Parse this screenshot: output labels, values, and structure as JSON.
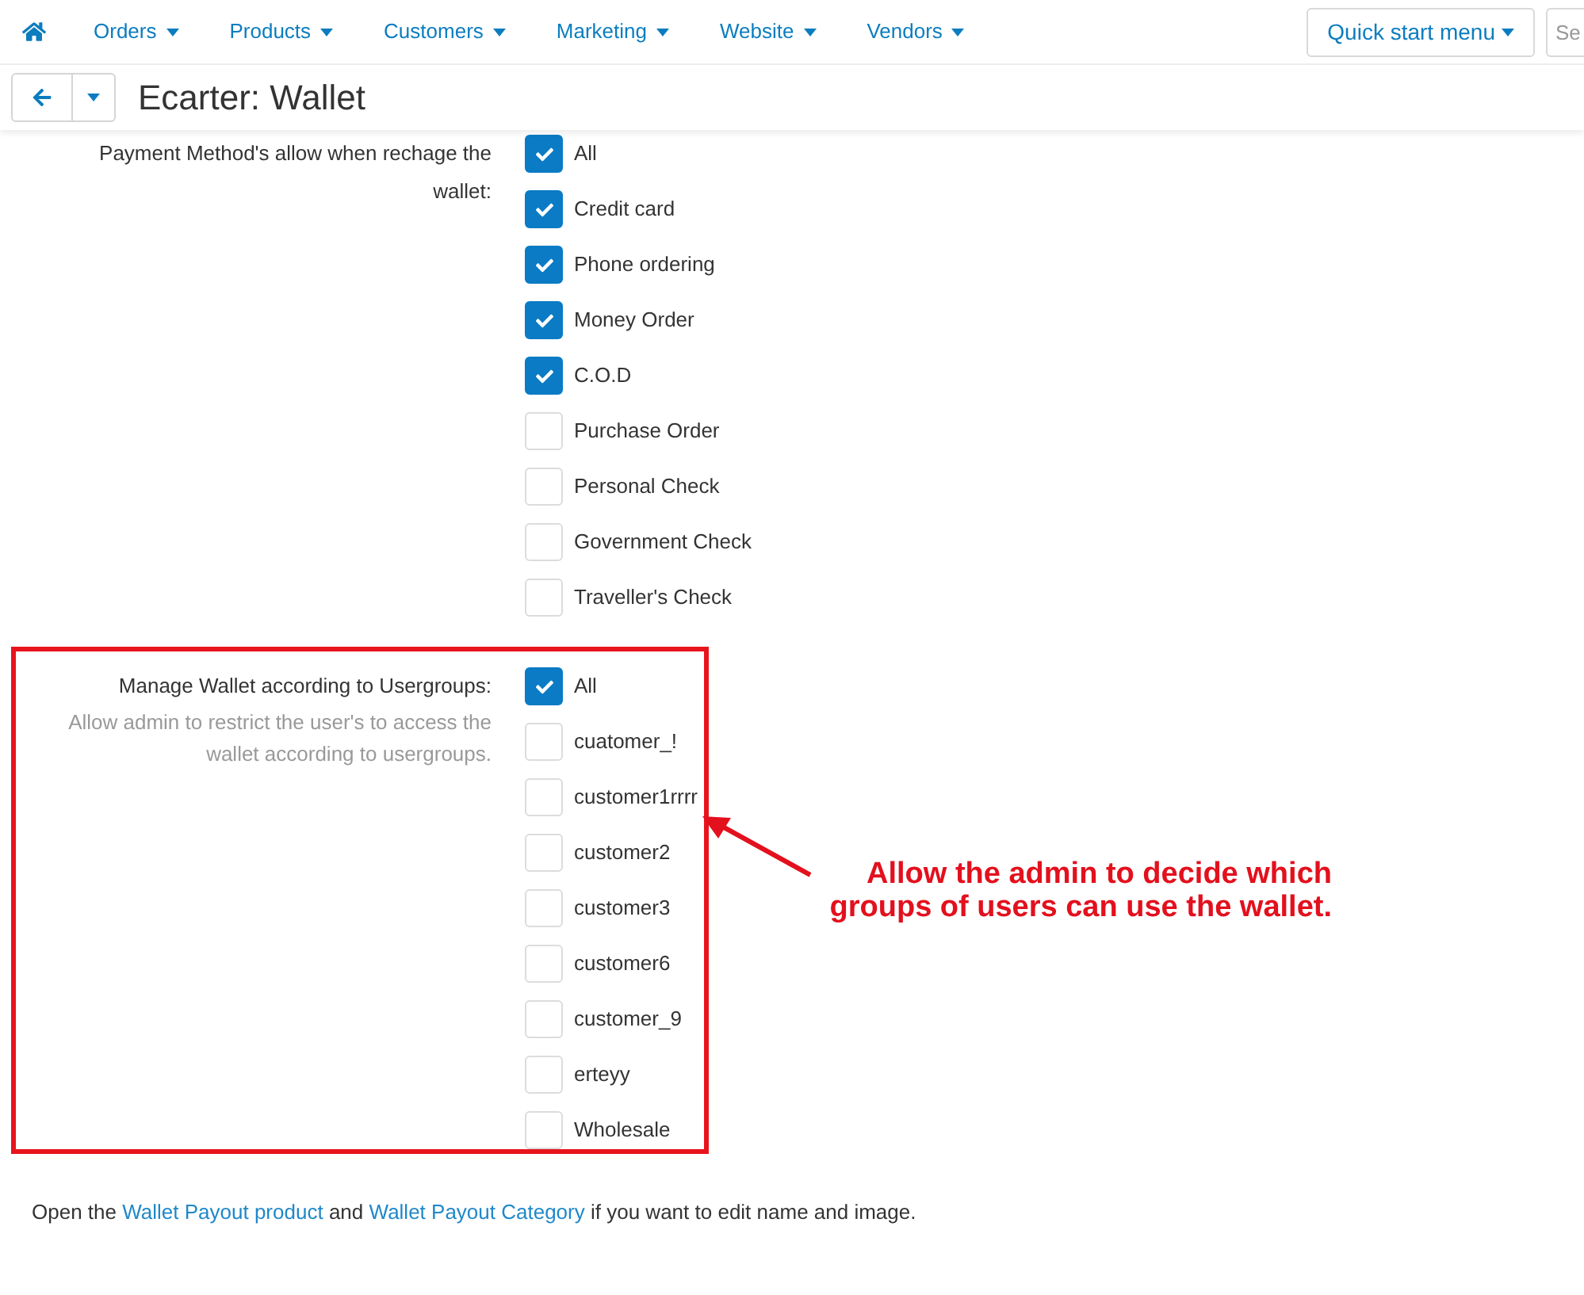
{
  "nav": {
    "items": [
      {
        "label": "Orders"
      },
      {
        "label": "Products"
      },
      {
        "label": "Customers"
      },
      {
        "label": "Marketing"
      },
      {
        "label": "Website"
      },
      {
        "label": "Vendors"
      }
    ],
    "quick_start": "Quick start menu",
    "search": {
      "placeholder": "Se"
    }
  },
  "toolbar": {
    "title": "Ecarter: Wallet"
  },
  "settings": [
    {
      "label": "Payment Method's allow when rechage the wallet:",
      "highlighted": false,
      "options": [
        {
          "label": "All",
          "checked": true
        },
        {
          "label": "Credit card",
          "checked": true
        },
        {
          "label": "Phone ordering",
          "checked": true
        },
        {
          "label": "Money Order",
          "checked": true
        },
        {
          "label": "C.O.D",
          "checked": true
        },
        {
          "label": "Purchase Order",
          "checked": false
        },
        {
          "label": "Personal Check",
          "checked": false
        },
        {
          "label": "Government Check",
          "checked": false
        },
        {
          "label": "Traveller's Check",
          "checked": false
        }
      ]
    },
    {
      "label": "Manage Wallet according to Usergroups:",
      "description": "Allow admin to restrict the user's to access the wallet according to usergroups.",
      "highlighted": true,
      "options": [
        {
          "label": "All",
          "checked": true
        },
        {
          "label": "cuatomer_!",
          "checked": false
        },
        {
          "label": "customer1rrrr",
          "checked": false
        },
        {
          "label": "customer2",
          "checked": false
        },
        {
          "label": "customer3",
          "checked": false
        },
        {
          "label": "customer6",
          "checked": false
        },
        {
          "label": "customer_9",
          "checked": false
        },
        {
          "label": "erteyy",
          "checked": false
        },
        {
          "label": "Wholesale",
          "checked": false
        }
      ]
    }
  ],
  "annotation": {
    "text": "Allow the admin to decide which groups of users can use the wallet."
  },
  "footer": {
    "segments": [
      {
        "kind": "text",
        "text": "Open the"
      },
      {
        "kind": "link",
        "text": "Wallet Payout product"
      },
      {
        "kind": "text",
        "text": "and"
      },
      {
        "kind": "link",
        "text": "Wallet Payout Category"
      },
      {
        "kind": "text",
        "text": "if you want to edit name and image."
      }
    ]
  }
}
